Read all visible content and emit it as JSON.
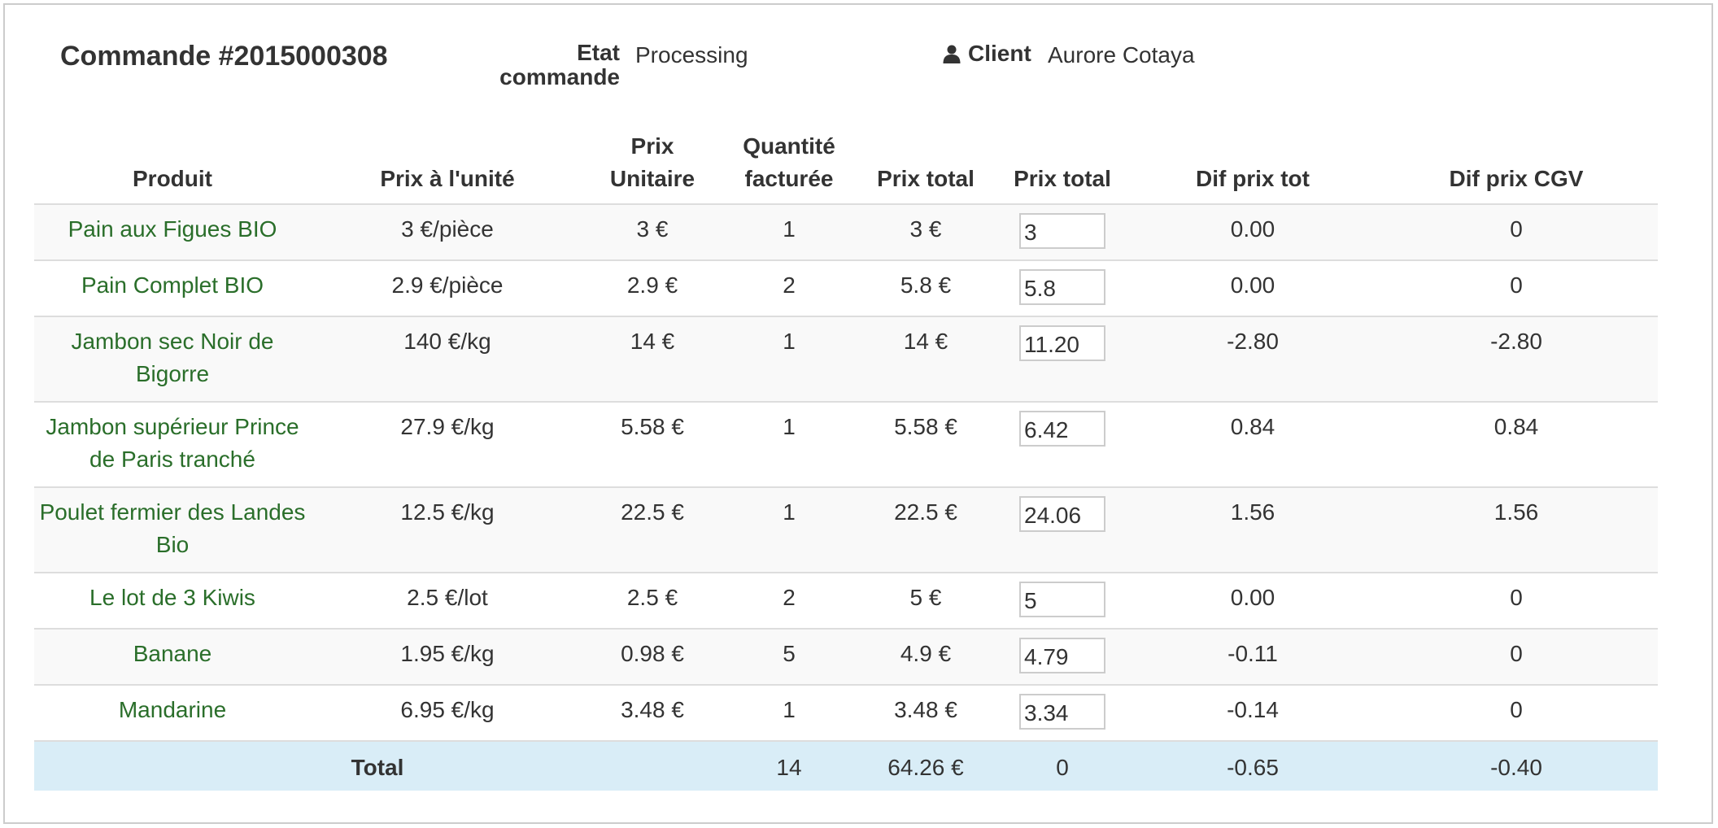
{
  "order": {
    "title": "Commande #2015000308",
    "status_label_line1": "Etat",
    "status_label_line2": "commande",
    "status_value": "Processing",
    "client_label": "Client",
    "client_value": "Aurore Cotaya"
  },
  "table": {
    "headers": [
      "Produit",
      "Prix à l'unité",
      "Prix Unitaire",
      "Quantité facturée",
      "Prix total",
      "Prix total",
      "Dif prix tot",
      "Dif prix CGV"
    ],
    "rows": [
      {
        "product": "Pain aux Figues BIO",
        "unit_price": "3 €/pièce",
        "prix_unitaire": "3 €",
        "qty": "1",
        "total": "3 €",
        "input": "3",
        "dif_tot": "0.00",
        "dif_cgv": "0"
      },
      {
        "product": "Pain Complet BIO",
        "unit_price": "2.9 €/pièce",
        "prix_unitaire": "2.9 €",
        "qty": "2",
        "total": "5.8 €",
        "input": "5.8",
        "dif_tot": "0.00",
        "dif_cgv": "0"
      },
      {
        "product": "Jambon sec Noir de Bigorre",
        "unit_price": "140 €/kg",
        "prix_unitaire": "14 €",
        "qty": "1",
        "total": "14 €",
        "input": "11.20",
        "dif_tot": "-2.80",
        "dif_cgv": "-2.80"
      },
      {
        "product": "Jambon supérieur Prince de Paris tranché",
        "unit_price": "27.9 €/kg",
        "prix_unitaire": "5.58 €",
        "qty": "1",
        "total": "5.58 €",
        "input": "6.42",
        "dif_tot": "0.84",
        "dif_cgv": "0.84"
      },
      {
        "product": "Poulet fermier des Landes Bio",
        "unit_price": "12.5 €/kg",
        "prix_unitaire": "22.5 €",
        "qty": "1",
        "total": "22.5 €",
        "input": "24.06",
        "dif_tot": "1.56",
        "dif_cgv": "1.56"
      },
      {
        "product": "Le lot de 3 Kiwis",
        "unit_price": "2.5 €/lot",
        "prix_unitaire": "2.5 €",
        "qty": "2",
        "total": "5 €",
        "input": "5",
        "dif_tot": "0.00",
        "dif_cgv": "0"
      },
      {
        "product": "Banane",
        "unit_price": "1.95 €/kg",
        "prix_unitaire": "0.98 €",
        "qty": "5",
        "total": "4.9 €",
        "input": "4.79",
        "dif_tot": "-0.11",
        "dif_cgv": "0"
      },
      {
        "product": "Mandarine",
        "unit_price": "6.95 €/kg",
        "prix_unitaire": "3.48 €",
        "qty": "1",
        "total": "3.48 €",
        "input": "3.34",
        "dif_tot": "-0.14",
        "dif_cgv": "0"
      }
    ],
    "total_row": {
      "label": "Total",
      "qty": "14",
      "total": "64.26 €",
      "input_total": "0",
      "dif_tot": "-0.65",
      "dif_cgv": "-0.40"
    }
  },
  "icons": {
    "client": "user-icon"
  },
  "colors": {
    "link": "#2a6e2a",
    "total_row_bg": "#d9edf7",
    "stripe_bg": "#f9f9f9"
  }
}
